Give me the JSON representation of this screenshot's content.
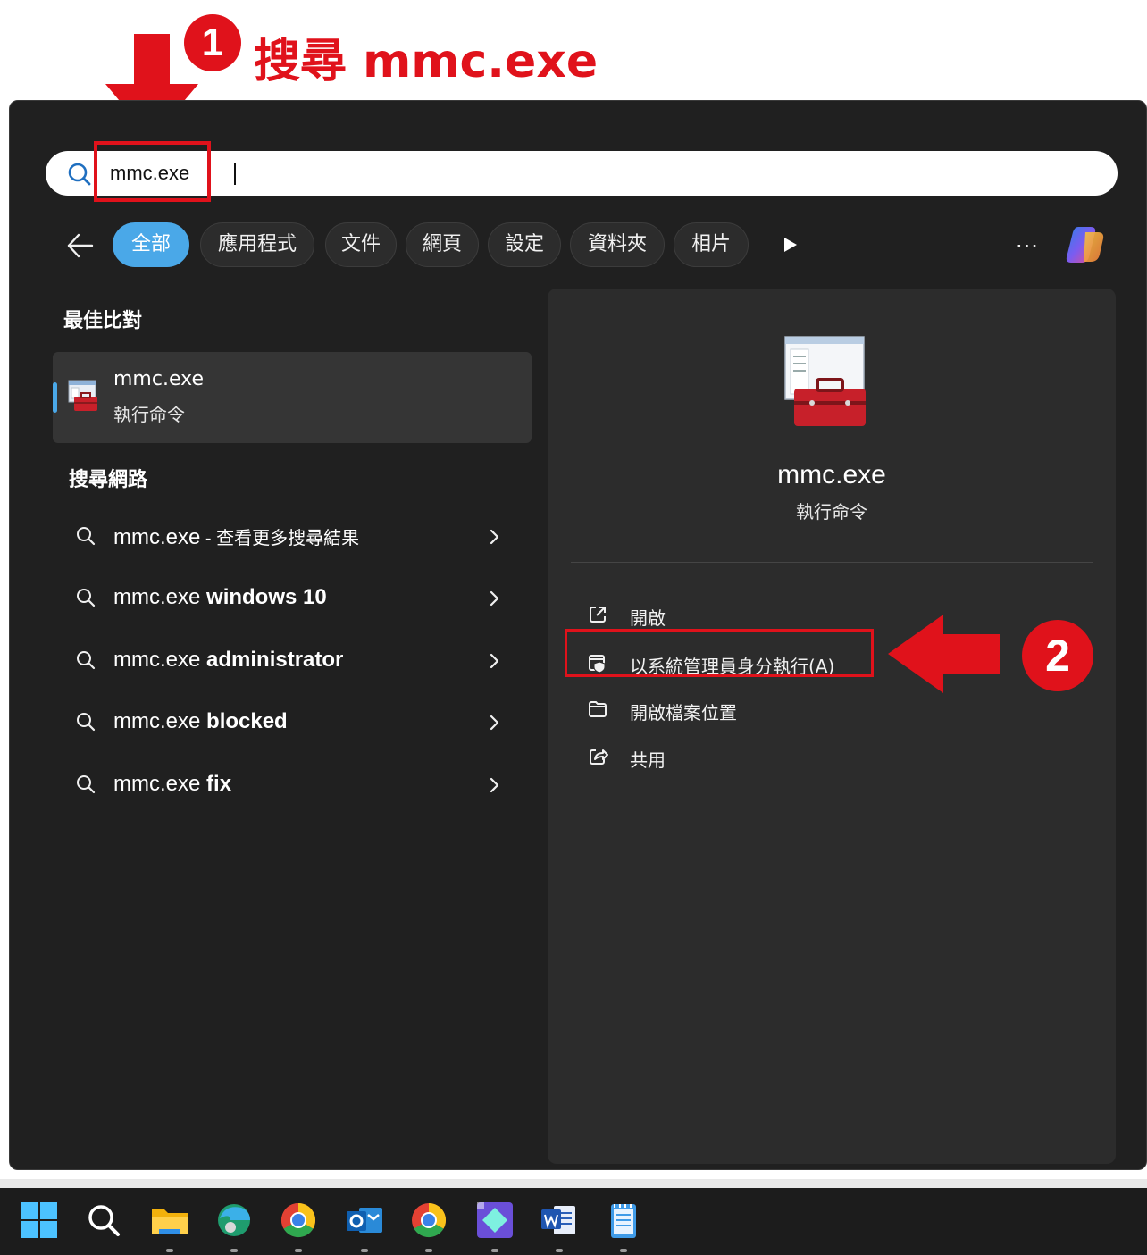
{
  "annotations": {
    "step1_badge": "1",
    "step1_text": "搜尋 mmc.exe",
    "step2_badge": "2",
    "accent_color": "#e0121b"
  },
  "search": {
    "value": "mmc.exe",
    "icon": "search-icon"
  },
  "filters": {
    "items": [
      {
        "label": "全部",
        "active": true
      },
      {
        "label": "應用程式"
      },
      {
        "label": "文件"
      },
      {
        "label": "網頁"
      },
      {
        "label": "設定"
      },
      {
        "label": "資料夾"
      },
      {
        "label": "相片"
      }
    ],
    "more_label": "···",
    "accent_color": "#4aa8e8"
  },
  "best_match": {
    "section_title": "最佳比對",
    "name": "mmc.exe",
    "type": "執行命令"
  },
  "web": {
    "section_title": "搜尋網路",
    "items": [
      {
        "query": "mmc.exe",
        "suffix": " - 查看更多搜尋結果"
      },
      {
        "query": "mmc.exe",
        "suffix": " windows 10"
      },
      {
        "query": "mmc.exe",
        "suffix": " administrator"
      },
      {
        "query": "mmc.exe",
        "suffix": " blocked"
      },
      {
        "query": "mmc.exe",
        "suffix": " fix"
      }
    ]
  },
  "detail": {
    "name": "mmc.exe",
    "type": "執行命令",
    "actions": [
      {
        "label": "開啟",
        "icon": "open-external-icon"
      },
      {
        "label": "以系統管理員身分執行(A)",
        "icon": "run-as-admin-icon"
      },
      {
        "label": "開啟檔案位置",
        "icon": "folder-icon"
      },
      {
        "label": "共用",
        "icon": "share-icon"
      }
    ]
  },
  "taskbar": {
    "items": [
      "start-icon",
      "search-icon",
      "file-explorer-icon",
      "edge-icon",
      "chrome-icon",
      "outlook-icon",
      "chrome-icon",
      "app-icon",
      "word-icon",
      "notepad-icon"
    ]
  }
}
